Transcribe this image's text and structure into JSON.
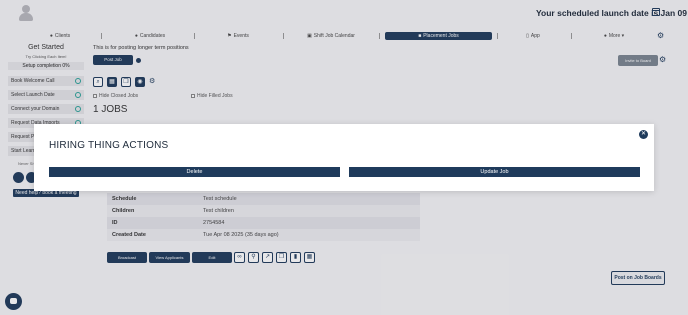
{
  "header": {
    "launch_text": "Your scheduled launch date is Jan 09"
  },
  "nav": {
    "items": [
      {
        "label": "Clients",
        "icon": "users-icon"
      },
      {
        "label": "Candidates",
        "icon": "person-icon"
      },
      {
        "label": "Events",
        "icon": "flag-icon"
      },
      {
        "label": "Shift Job Calendar",
        "icon": "calendar-icon"
      },
      {
        "label": "Placement Jobs",
        "icon": "briefcase-icon"
      },
      {
        "label": "App",
        "icon": "phone-icon"
      },
      {
        "label": "More ▾",
        "icon": "chat-icon"
      }
    ]
  },
  "sidebar": {
    "title": "Get Started",
    "subtitle": "Try Clicking Each Item!",
    "setup": "Setup completion 0%",
    "items": [
      {
        "label": "Book Welcome Call"
      },
      {
        "label": "Select Launch Date"
      },
      {
        "label": "Connect your Domain"
      },
      {
        "label": "Request Data Imports"
      },
      {
        "label": "Request Pi"
      },
      {
        "label": "Start Learn"
      }
    ],
    "never": "Never Sh",
    "help_tooltip": "Need help? book a meeting"
  },
  "main": {
    "intro": "This is for posting longer term positions",
    "post_job": "Post Job",
    "invite": "Invite to Board",
    "hide_closed": "Hide Closed Jobs",
    "hide_filled": "Hide Filled Jobs",
    "jobs_count": "1 JOBS",
    "details": [
      {
        "key": "Schedule",
        "value": "Test schedule"
      },
      {
        "key": "Children",
        "value": "Test children"
      },
      {
        "key": "ID",
        "value": "2754584"
      },
      {
        "key": "Created Date",
        "value": "Tue Apr 08 2025 (35 days ago)"
      }
    ],
    "actions": {
      "broadcast": "Broadcast",
      "view_applicants": "View Applicants",
      "edit": "Edit"
    },
    "post_boards": "Post on Job Boards"
  },
  "modal": {
    "title": "HIRING THING ACTIONS",
    "delete": "Delete",
    "update": "Update Job"
  }
}
